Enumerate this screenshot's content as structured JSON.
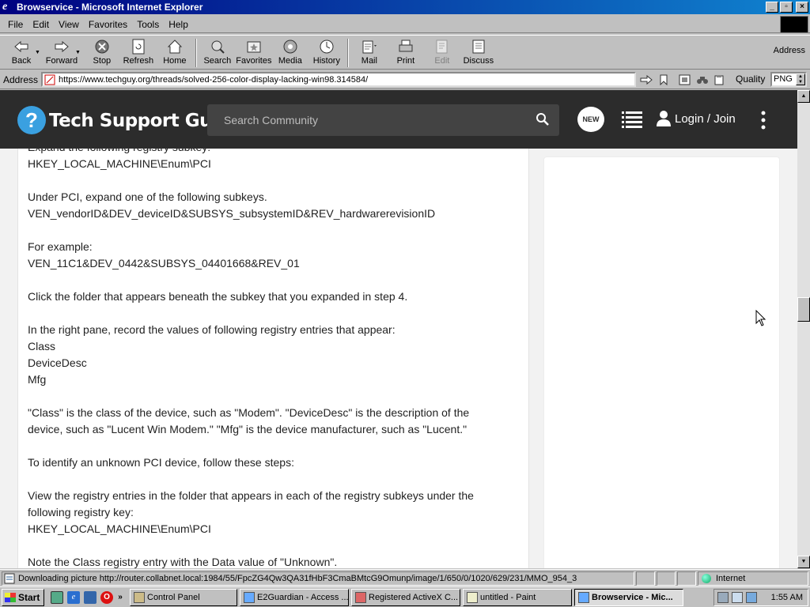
{
  "window": {
    "title": "Browservice - Microsoft Internet Explorer"
  },
  "menu": {
    "items": [
      "File",
      "Edit",
      "View",
      "Favorites",
      "Tools",
      "Help"
    ]
  },
  "toolbar": {
    "back": "Back",
    "forward": "Forward",
    "stop": "Stop",
    "refresh": "Refresh",
    "home": "Home",
    "search": "Search",
    "favorites": "Favorites",
    "media": "Media",
    "history": "History",
    "mail": "Mail",
    "print": "Print",
    "edit": "Edit",
    "discuss": "Discuss",
    "address_right": "Address"
  },
  "address": {
    "label": "Address",
    "url": "https://www.techguy.org/threads/solved-256-color-display-lacking-win98.314584/",
    "quality_label": "Quality",
    "quality_value": "PNG"
  },
  "site": {
    "logo_mark": "?",
    "name": "Tech Support Guy",
    "search_placeholder": "Search Community",
    "new_badge": "NEW",
    "login": "Login / Join"
  },
  "post": {
    "lines": [
      "Expand the following registry subkey:",
      "HKEY_LOCAL_MACHINE\\Enum\\PCI",
      "",
      "Under PCI, expand one of the following subkeys.",
      "VEN_vendorID&DEV_deviceID&SUBSYS_subsystemID&REV_hardwarerevisionID",
      "",
      "For example:",
      "VEN_11C1&DEV_0442&SUBSYS_04401668&REV_01",
      "",
      "Click the folder that appears beneath the subkey that you expanded in step 4.",
      "",
      "In the right pane, record the values of following registry entries that appear:",
      "Class",
      "DeviceDesc",
      "Mfg",
      "",
      "\"Class\" is the class of the device, such as \"Modem\". \"DeviceDesc\" is the description of the",
      "device, such as \"Lucent Win Modem.\" \"Mfg\" is the device manufacturer, such as \"Lucent.\"",
      "",
      "To identify an unknown PCI device, follow these steps:",
      "",
      "View the registry entries in the folder that appears in each of the registry subkeys under the",
      "following registry key:",
      "HKEY_LOCAL_MACHINE\\Enum\\PCI",
      "",
      "Note the Class registry entry with the Data value of \"Unknown\"."
    ]
  },
  "status": {
    "text": "Downloading picture http://router.collabnet.local:1984/55/FpcZG4Qw3QA31fHbF3CmaBMtcG9Omunp/image/1/650/0/1020/629/231/MMO_954_3",
    "zone": "Internet"
  },
  "taskbar": {
    "start": "Start",
    "tasks": [
      "Control Panel",
      "E2Guardian - Access ...",
      "Registered ActiveX C...",
      "untitled - Paint",
      "Browservice - Mic..."
    ],
    "clock": "1:55 AM"
  }
}
